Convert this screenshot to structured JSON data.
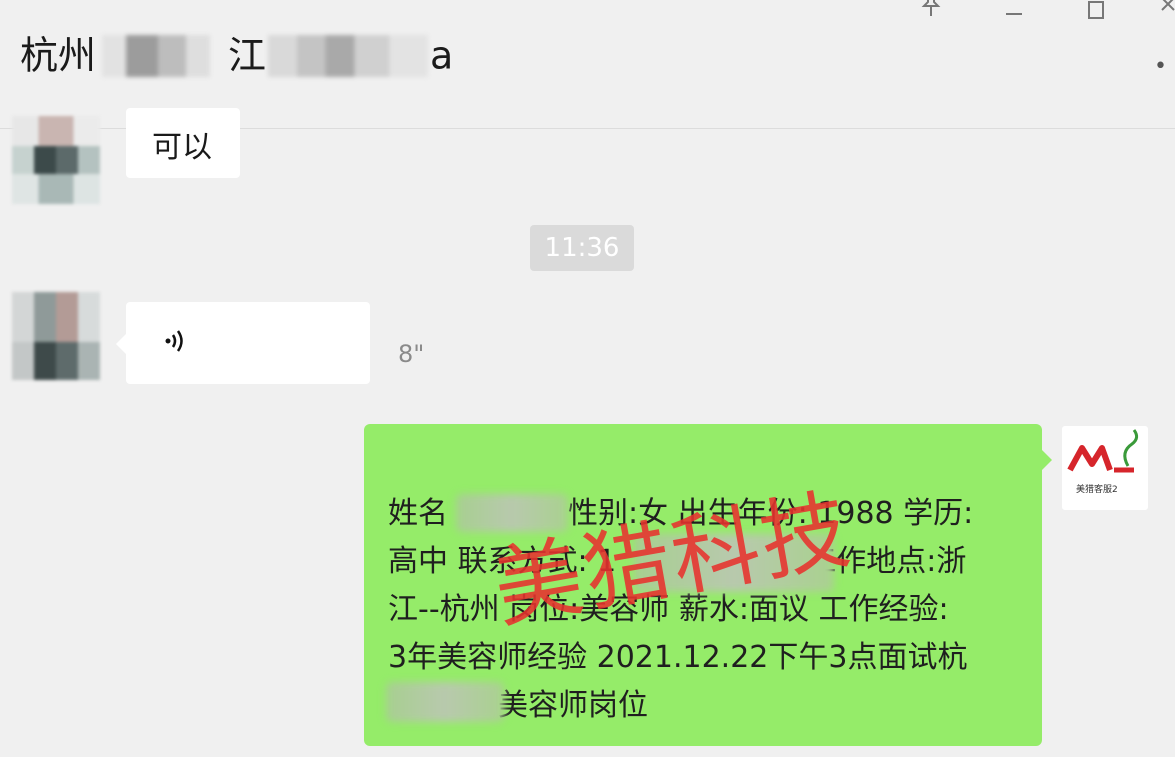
{
  "header": {
    "title_part1": "杭州",
    "title_part2": "江",
    "title_part3": "a",
    "pin_icon": "pin-icon",
    "minimize_icon": "minimize-icon",
    "maximize_icon": "maximize-icon",
    "close_icon": "close-icon",
    "more_icon": "more-dots-icon"
  },
  "messages": [
    {
      "type": "text",
      "side": "left",
      "text": "可以"
    },
    {
      "type": "timestamp",
      "text": "11:36"
    },
    {
      "type": "voice",
      "side": "left",
      "icon": "voice-wave-icon",
      "duration": "8\""
    }
  ],
  "resume_message": {
    "side": "right",
    "lines": [
      {
        "a": "姓名",
        "b": "性别:女 出生年份: 1988 学历:"
      },
      {
        "a": "高中 联系方式: 1",
        "b": "工作地点:浙"
      },
      {
        "a": "江--杭州 岗位:美容师 薪水:面议 工作经验:"
      },
      {
        "a": "3年美容师经验 2021.12.22下午3点面试杭"
      },
      {
        "a": "美容师岗位"
      }
    ]
  },
  "watermark": "美猎科技",
  "sender_logo": {
    "caption": "美猎客服2"
  },
  "colors": {
    "green_bubble": "#95ec69",
    "watermark": "#e8322e",
    "timestamp_bg": "#dadada"
  }
}
